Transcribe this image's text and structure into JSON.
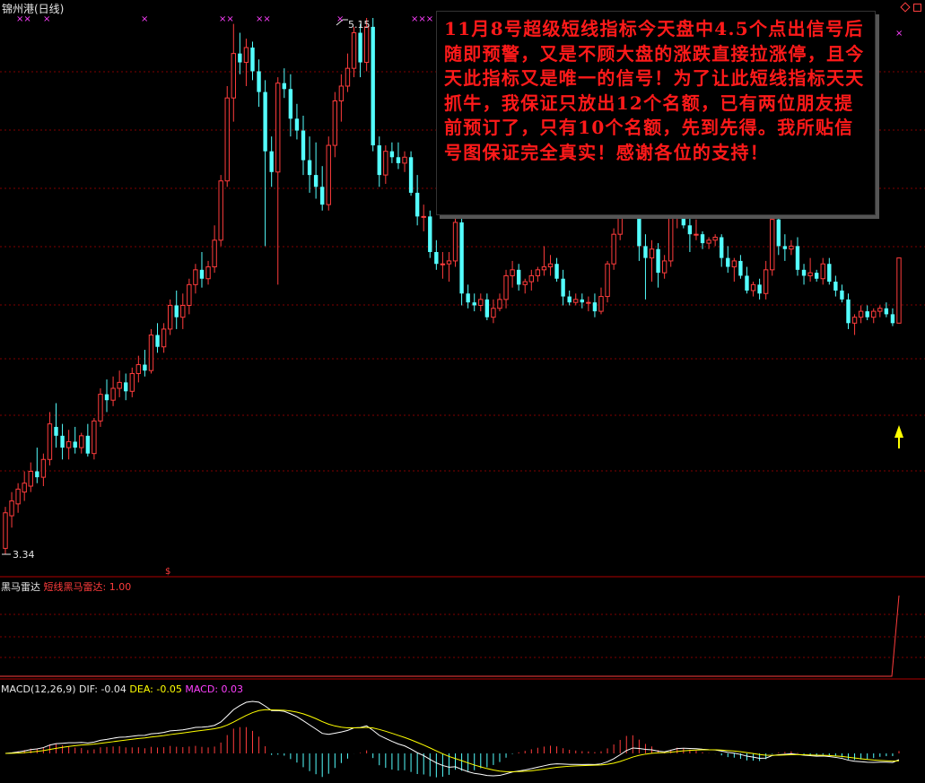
{
  "stock": {
    "title": "锦州港(日线)"
  },
  "price_labels": {
    "high": "5.15",
    "low": "3.34"
  },
  "annotation": {
    "text": "11月8号超级短线指标今天盘中4.5个点出信号后随即预警，又是不顾大盘的涨跌直接拉涨停，且今天此指标又是唯一的信号！为了让此短线指标天天抓牛，我保证只放出12个名额，已有两位朋友提前预订了，只有10个名额，先到先得。我所贴信号图保证完全真实！感谢各位的支持！"
  },
  "indicator": {
    "name": "黑马雷达",
    "label": "短线黑马雷达:",
    "value": "1.00"
  },
  "macd": {
    "name": "MACD(12,26,9)",
    "dif_label": "DIF:",
    "dif": "-0.04",
    "dea_label": "DEA:",
    "dea": "-0.05",
    "macd_label": "MACD:",
    "macd": "0.03"
  },
  "colors": {
    "up": "#ff3c3c",
    "down": "#54ffff",
    "dif": "#ffffff",
    "dea": "#ffff00",
    "grid": "#800000",
    "signal": "#ff40ff",
    "arrow": "#ffff00"
  },
  "chart_data": {
    "type": "candlestick",
    "title": "锦州港(日线)",
    "ylim": [
      3.34,
      5.15
    ],
    "candles": [
      {
        "o": 3.36,
        "h": 3.5,
        "l": 3.34,
        "c": 3.48
      },
      {
        "o": 3.47,
        "h": 3.55,
        "l": 3.43,
        "c": 3.52
      },
      {
        "o": 3.51,
        "h": 3.58,
        "l": 3.48,
        "c": 3.56
      },
      {
        "o": 3.55,
        "h": 3.62,
        "l": 3.52,
        "c": 3.58
      },
      {
        "o": 3.57,
        "h": 3.65,
        "l": 3.55,
        "c": 3.62
      },
      {
        "o": 3.62,
        "h": 3.7,
        "l": 3.58,
        "c": 3.6
      },
      {
        "o": 3.6,
        "h": 3.68,
        "l": 3.57,
        "c": 3.66
      },
      {
        "o": 3.66,
        "h": 3.82,
        "l": 3.64,
        "c": 3.78
      },
      {
        "o": 3.77,
        "h": 3.85,
        "l": 3.7,
        "c": 3.74
      },
      {
        "o": 3.74,
        "h": 3.78,
        "l": 3.66,
        "c": 3.7
      },
      {
        "o": 3.7,
        "h": 3.76,
        "l": 3.66,
        "c": 3.72
      },
      {
        "o": 3.72,
        "h": 3.77,
        "l": 3.68,
        "c": 3.7
      },
      {
        "o": 3.7,
        "h": 3.75,
        "l": 3.68,
        "c": 3.74
      },
      {
        "o": 3.74,
        "h": 3.78,
        "l": 3.67,
        "c": 3.68
      },
      {
        "o": 3.68,
        "h": 3.8,
        "l": 3.66,
        "c": 3.79
      },
      {
        "o": 3.79,
        "h": 3.9,
        "l": 3.77,
        "c": 3.88
      },
      {
        "o": 3.88,
        "h": 3.93,
        "l": 3.82,
        "c": 3.86
      },
      {
        "o": 3.86,
        "h": 3.94,
        "l": 3.84,
        "c": 3.9
      },
      {
        "o": 3.9,
        "h": 3.96,
        "l": 3.87,
        "c": 3.92
      },
      {
        "o": 3.92,
        "h": 3.95,
        "l": 3.86,
        "c": 3.89
      },
      {
        "o": 3.89,
        "h": 3.97,
        "l": 3.87,
        "c": 3.95
      },
      {
        "o": 3.95,
        "h": 4.01,
        "l": 3.92,
        "c": 3.98
      },
      {
        "o": 3.98,
        "h": 4.03,
        "l": 3.94,
        "c": 3.96
      },
      {
        "o": 3.96,
        "h": 4.1,
        "l": 3.95,
        "c": 4.08
      },
      {
        "o": 4.08,
        "h": 4.12,
        "l": 4.02,
        "c": 4.04
      },
      {
        "o": 4.04,
        "h": 4.12,
        "l": 4.02,
        "c": 4.1
      },
      {
        "o": 4.1,
        "h": 4.2,
        "l": 4.08,
        "c": 4.18
      },
      {
        "o": 4.18,
        "h": 4.23,
        "l": 4.1,
        "c": 4.14
      },
      {
        "o": 4.14,
        "h": 4.22,
        "l": 4.1,
        "c": 4.18
      },
      {
        "o": 4.18,
        "h": 4.27,
        "l": 4.15,
        "c": 4.25
      },
      {
        "o": 4.25,
        "h": 4.32,
        "l": 4.22,
        "c": 4.3
      },
      {
        "o": 4.3,
        "h": 4.36,
        "l": 4.24,
        "c": 4.27
      },
      {
        "o": 4.27,
        "h": 4.33,
        "l": 4.25,
        "c": 4.31
      },
      {
        "o": 4.31,
        "h": 4.45,
        "l": 4.29,
        "c": 4.4
      },
      {
        "o": 4.4,
        "h": 4.62,
        "l": 4.38,
        "c": 4.6
      },
      {
        "o": 4.6,
        "h": 4.92,
        "l": 4.58,
        "c": 4.88
      },
      {
        "o": 4.88,
        "h": 5.13,
        "l": 4.8,
        "c": 5.03
      },
      {
        "o": 5.03,
        "h": 5.1,
        "l": 4.96,
        "c": 5.0
      },
      {
        "o": 5.0,
        "h": 5.08,
        "l": 4.92,
        "c": 5.05
      },
      {
        "o": 5.05,
        "h": 5.07,
        "l": 4.94,
        "c": 4.97
      },
      {
        "o": 4.97,
        "h": 5.01,
        "l": 4.85,
        "c": 4.9
      },
      {
        "o": 4.9,
        "h": 4.94,
        "l": 4.38,
        "c": 4.7
      },
      {
        "o": 4.7,
        "h": 4.75,
        "l": 4.58,
        "c": 4.63
      },
      {
        "o": 4.63,
        "h": 4.95,
        "l": 4.25,
        "c": 4.93
      },
      {
        "o": 4.93,
        "h": 4.98,
        "l": 4.88,
        "c": 4.91
      },
      {
        "o": 4.91,
        "h": 4.96,
        "l": 4.75,
        "c": 4.81
      },
      {
        "o": 4.81,
        "h": 4.86,
        "l": 4.74,
        "c": 4.77
      },
      {
        "o": 4.77,
        "h": 4.82,
        "l": 4.62,
        "c": 4.67
      },
      {
        "o": 4.67,
        "h": 4.75,
        "l": 4.56,
        "c": 4.62
      },
      {
        "o": 4.62,
        "h": 4.73,
        "l": 4.54,
        "c": 4.58
      },
      {
        "o": 4.58,
        "h": 4.65,
        "l": 4.5,
        "c": 4.52
      },
      {
        "o": 4.52,
        "h": 4.75,
        "l": 4.5,
        "c": 4.72
      },
      {
        "o": 4.72,
        "h": 4.9,
        "l": 4.68,
        "c": 4.87
      },
      {
        "o": 4.87,
        "h": 4.96,
        "l": 4.8,
        "c": 4.92
      },
      {
        "o": 4.92,
        "h": 5.03,
        "l": 4.9,
        "c": 4.98
      },
      {
        "o": 4.98,
        "h": 5.12,
        "l": 4.95,
        "c": 5.1
      },
      {
        "o": 5.1,
        "h": 5.13,
        "l": 4.95,
        "c": 5.0
      },
      {
        "o": 5.0,
        "h": 5.15,
        "l": 4.97,
        "c": 5.12
      },
      {
        "o": 5.12,
        "h": 5.15,
        "l": 4.7,
        "c": 4.72
      },
      {
        "o": 4.72,
        "h": 4.75,
        "l": 4.58,
        "c": 4.62
      },
      {
        "o": 4.62,
        "h": 4.72,
        "l": 4.59,
        "c": 4.7
      },
      {
        "o": 4.7,
        "h": 4.73,
        "l": 4.66,
        "c": 4.68
      },
      {
        "o": 4.68,
        "h": 4.73,
        "l": 4.64,
        "c": 4.66
      },
      {
        "o": 4.66,
        "h": 4.7,
        "l": 4.63,
        "c": 4.68
      },
      {
        "o": 4.68,
        "h": 4.7,
        "l": 4.55,
        "c": 4.56
      },
      {
        "o": 4.56,
        "h": 4.62,
        "l": 4.45,
        "c": 4.48
      },
      {
        "o": 4.48,
        "h": 4.52,
        "l": 4.43,
        "c": 4.48
      },
      {
        "o": 4.48,
        "h": 4.5,
        "l": 4.34,
        "c": 4.36
      },
      {
        "o": 4.36,
        "h": 4.4,
        "l": 4.3,
        "c": 4.32
      },
      {
        "o": 4.32,
        "h": 4.36,
        "l": 4.27,
        "c": 4.32
      },
      {
        "o": 4.32,
        "h": 4.36,
        "l": 4.26,
        "c": 4.33
      },
      {
        "o": 4.33,
        "h": 4.49,
        "l": 4.31,
        "c": 4.46
      },
      {
        "o": 4.46,
        "h": 4.48,
        "l": 4.18,
        "c": 4.22
      },
      {
        "o": 4.22,
        "h": 4.25,
        "l": 4.17,
        "c": 4.19
      },
      {
        "o": 4.19,
        "h": 4.22,
        "l": 4.16,
        "c": 4.18
      },
      {
        "o": 4.18,
        "h": 4.22,
        "l": 4.16,
        "c": 4.2
      },
      {
        "o": 4.2,
        "h": 4.22,
        "l": 4.13,
        "c": 4.14
      },
      {
        "o": 4.14,
        "h": 4.2,
        "l": 4.12,
        "c": 4.17
      },
      {
        "o": 4.17,
        "h": 4.22,
        "l": 4.16,
        "c": 4.2
      },
      {
        "o": 4.2,
        "h": 4.3,
        "l": 4.17,
        "c": 4.28
      },
      {
        "o": 4.28,
        "h": 4.33,
        "l": 4.24,
        "c": 4.3
      },
      {
        "o": 4.3,
        "h": 4.32,
        "l": 4.23,
        "c": 4.25
      },
      {
        "o": 4.25,
        "h": 4.27,
        "l": 4.22,
        "c": 4.26
      },
      {
        "o": 4.26,
        "h": 4.3,
        "l": 4.23,
        "c": 4.28
      },
      {
        "o": 4.28,
        "h": 4.31,
        "l": 4.26,
        "c": 4.3
      },
      {
        "o": 4.3,
        "h": 4.38,
        "l": 4.28,
        "c": 4.31
      },
      {
        "o": 4.31,
        "h": 4.35,
        "l": 4.28,
        "c": 4.32
      },
      {
        "o": 4.32,
        "h": 4.34,
        "l": 4.26,
        "c": 4.27
      },
      {
        "o": 4.27,
        "h": 4.3,
        "l": 4.18,
        "c": 4.21
      },
      {
        "o": 4.21,
        "h": 4.23,
        "l": 4.18,
        "c": 4.19
      },
      {
        "o": 4.19,
        "h": 4.22,
        "l": 4.18,
        "c": 4.2
      },
      {
        "o": 4.2,
        "h": 4.22,
        "l": 4.17,
        "c": 4.19
      },
      {
        "o": 4.19,
        "h": 4.21,
        "l": 4.16,
        "c": 4.19
      },
      {
        "o": 4.19,
        "h": 4.22,
        "l": 4.14,
        "c": 4.16
      },
      {
        "o": 4.16,
        "h": 4.24,
        "l": 4.15,
        "c": 4.21
      },
      {
        "o": 4.21,
        "h": 4.33,
        "l": 4.19,
        "c": 4.32
      },
      {
        "o": 4.32,
        "h": 4.44,
        "l": 4.3,
        "c": 4.42
      },
      {
        "o": 4.42,
        "h": 4.56,
        "l": 4.4,
        "c": 4.53
      },
      {
        "o": 4.53,
        "h": 4.66,
        "l": 4.5,
        "c": 4.61
      },
      {
        "o": 4.61,
        "h": 4.72,
        "l": 4.52,
        "c": 4.56
      },
      {
        "o": 4.56,
        "h": 4.6,
        "l": 4.33,
        "c": 4.38
      },
      {
        "o": 4.38,
        "h": 4.42,
        "l": 4.2,
        "c": 4.34
      },
      {
        "o": 4.34,
        "h": 4.4,
        "l": 4.26,
        "c": 4.37
      },
      {
        "o": 4.37,
        "h": 4.39,
        "l": 4.24,
        "c": 4.29
      },
      {
        "o": 4.29,
        "h": 4.35,
        "l": 4.27,
        "c": 4.33
      },
      {
        "o": 4.33,
        "h": 4.5,
        "l": 4.31,
        "c": 4.48
      },
      {
        "o": 4.48,
        "h": 4.55,
        "l": 4.44,
        "c": 4.52
      },
      {
        "o": 4.52,
        "h": 4.56,
        "l": 4.44,
        "c": 4.45
      },
      {
        "o": 4.45,
        "h": 4.48,
        "l": 4.36,
        "c": 4.42
      },
      {
        "o": 4.42,
        "h": 4.47,
        "l": 4.4,
        "c": 4.42
      },
      {
        "o": 4.42,
        "h": 4.43,
        "l": 4.37,
        "c": 4.39
      },
      {
        "o": 4.39,
        "h": 4.41,
        "l": 4.37,
        "c": 4.4
      },
      {
        "o": 4.4,
        "h": 4.42,
        "l": 4.38,
        "c": 4.41
      },
      {
        "o": 4.41,
        "h": 4.42,
        "l": 4.31,
        "c": 4.34
      },
      {
        "o": 4.34,
        "h": 4.38,
        "l": 4.29,
        "c": 4.31
      },
      {
        "o": 4.31,
        "h": 4.34,
        "l": 4.26,
        "c": 4.33
      },
      {
        "o": 4.33,
        "h": 4.35,
        "l": 4.27,
        "c": 4.28
      },
      {
        "o": 4.28,
        "h": 4.31,
        "l": 4.22,
        "c": 4.23
      },
      {
        "o": 4.23,
        "h": 4.26,
        "l": 4.21,
        "c": 4.25
      },
      {
        "o": 4.25,
        "h": 4.27,
        "l": 4.2,
        "c": 4.22
      },
      {
        "o": 4.22,
        "h": 4.33,
        "l": 4.2,
        "c": 4.3
      },
      {
        "o": 4.3,
        "h": 4.5,
        "l": 4.28,
        "c": 4.47
      },
      {
        "o": 4.47,
        "h": 4.5,
        "l": 4.35,
        "c": 4.38
      },
      {
        "o": 4.38,
        "h": 4.42,
        "l": 4.33,
        "c": 4.37
      },
      {
        "o": 4.37,
        "h": 4.4,
        "l": 4.35,
        "c": 4.38
      },
      {
        "o": 4.38,
        "h": 4.41,
        "l": 4.28,
        "c": 4.3
      },
      {
        "o": 4.3,
        "h": 4.32,
        "l": 4.25,
        "c": 4.28
      },
      {
        "o": 4.28,
        "h": 4.34,
        "l": 4.26,
        "c": 4.29
      },
      {
        "o": 4.29,
        "h": 4.3,
        "l": 4.26,
        "c": 4.27
      },
      {
        "o": 4.27,
        "h": 4.34,
        "l": 4.25,
        "c": 4.32
      },
      {
        "o": 4.32,
        "h": 4.34,
        "l": 4.25,
        "c": 4.26
      },
      {
        "o": 4.26,
        "h": 4.28,
        "l": 4.21,
        "c": 4.23
      },
      {
        "o": 4.23,
        "h": 4.25,
        "l": 4.19,
        "c": 4.2
      },
      {
        "o": 4.2,
        "h": 4.22,
        "l": 4.1,
        "c": 4.12
      },
      {
        "o": 4.12,
        "h": 4.15,
        "l": 4.08,
        "c": 4.14
      },
      {
        "o": 4.14,
        "h": 4.18,
        "l": 4.12,
        "c": 4.16
      },
      {
        "o": 4.16,
        "h": 4.18,
        "l": 4.13,
        "c": 4.14
      },
      {
        "o": 4.14,
        "h": 4.17,
        "l": 4.12,
        "c": 4.16
      },
      {
        "o": 4.16,
        "h": 4.18,
        "l": 4.14,
        "c": 4.17
      },
      {
        "o": 4.17,
        "h": 4.19,
        "l": 4.14,
        "c": 4.15
      },
      {
        "o": 4.15,
        "h": 4.17,
        "l": 4.11,
        "c": 4.12
      },
      {
        "o": 4.12,
        "h": 4.34,
        "l": 4.12,
        "c": 4.34
      }
    ],
    "signal_markers": [
      "××",
      "×",
      "×",
      "××",
      "××",
      "×",
      "×××"
    ],
    "indicator": {
      "name": "短线黑马雷达",
      "value": 1.0
    },
    "macd": {
      "params": "12,26,9",
      "dif": -0.04,
      "dea": -0.05,
      "macd": 0.03
    }
  }
}
